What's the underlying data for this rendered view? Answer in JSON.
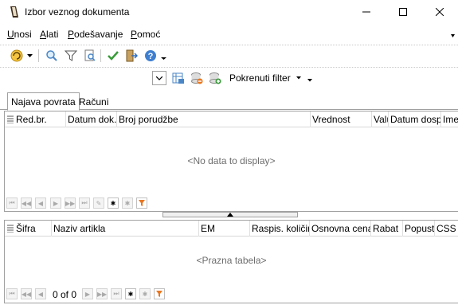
{
  "window": {
    "title": "Izbor veznog dokumenta"
  },
  "menu": [
    {
      "label": "Unosi",
      "accel": "U",
      "rest": "nosi"
    },
    {
      "label": "Alati",
      "accel": "A",
      "rest": "lati"
    },
    {
      "label": "Podešavanje",
      "accel": "P",
      "rest": "odešavanje"
    },
    {
      "label": "Pomoć",
      "accel": "P",
      "rest": "omoć"
    }
  ],
  "toolbar2": {
    "filter_label": "Pokrenuti filter"
  },
  "tabs": [
    {
      "label": "Najava povrata",
      "active": true
    },
    {
      "label": "Računi",
      "active": false
    }
  ],
  "grid1": {
    "columns": [
      "Red.br.",
      "Datum dok.",
      "Broj porudžbe",
      "Vrednost",
      "Valuta",
      "Datum dosp",
      "Ime"
    ],
    "empty_message": "<No data to display>"
  },
  "grid2": {
    "columns": [
      "Šifra",
      "Naziv artikla",
      "EM",
      "Raspis. količina",
      "Osnovna cena",
      "Rabat",
      "Popust",
      "CSS"
    ],
    "empty_message": "<Prazna tabela>",
    "position": "0 of 0"
  },
  "colors": {
    "accent": "#e87722",
    "border": "#a0a0a0",
    "muted_text": "#6d6d6d"
  }
}
